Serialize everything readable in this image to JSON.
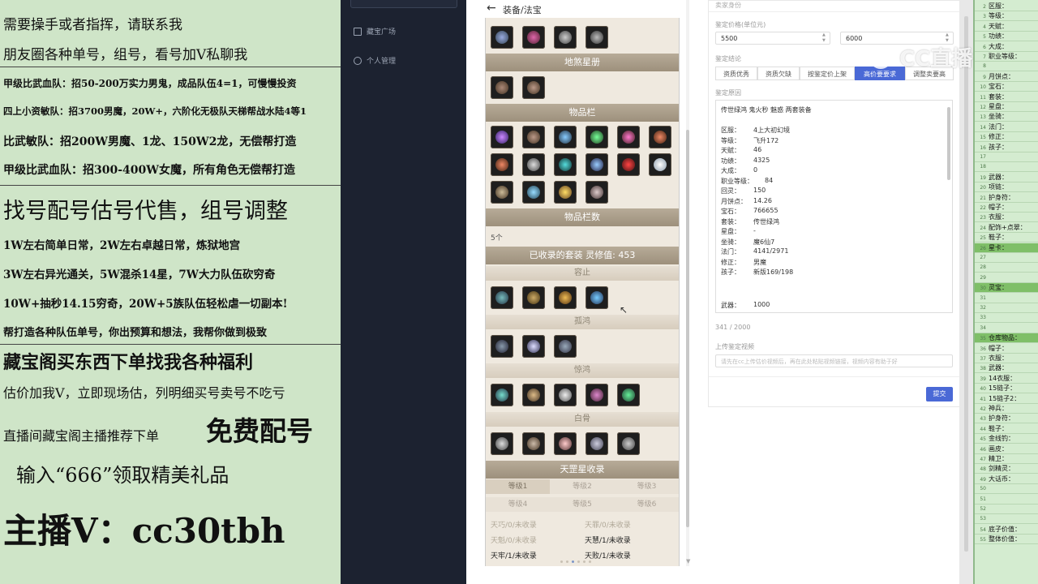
{
  "promo": {
    "lines": [
      "需要操手或者指挥，请联系我",
      "朋友圈各种单号，组号，看号加V私聊我",
      "甲级比武血队：招50-200万实力男鬼，成品队伍4=1，可慢慢投资",
      "四上小资敏队：招3700男魔，20W+，六阶化无极队天梯帮战水陆4等1",
      "比武敏队：招200W男魔、1龙、150W2龙，无偿帮打造",
      "甲级比武血队：招300-400W女魔，所有角色无偿帮打造",
      "找号配号估号代售，组号调整",
      "1W左右简单日常，2W左右卓越日常，炼狱地宫",
      "3W左右异光通关，5W混杀14星，7W大力队伍砍穷奇",
      "10W+抽秒14.15穷奇，20W+5族队伍轻松虐一切副本!",
      "帮打造各种队伍单号，你出预算和想法，我帮你做到极致",
      "藏宝阁买东西下单找我各种福利",
      "估价加我V，立即现场估，列明细买号卖号不吃亏",
      "直播间藏宝阁主播推荐下单",
      "免费配号",
      "输入“666”领取精美礼品",
      "主播V：cc30tbh"
    ]
  },
  "nav": {
    "items": [
      {
        "label": "藏宝广场",
        "icon": "store-icon"
      },
      {
        "label": "个人管理",
        "icon": "user-icon"
      }
    ]
  },
  "phone": {
    "title": "装备/法宝",
    "sections": {
      "star_album": "地煞星册",
      "inventory": "物品栏",
      "inventory_count_label": "物品栏数",
      "inventory_count": "5个",
      "suits_collected": "已收录的套装 灵修值: 453",
      "suit1": "容止",
      "suit2": "孤鸿",
      "suit3": "惊鸿",
      "suit4": "白骨",
      "tiangang": "天罡星收录"
    },
    "levels": [
      "等级1",
      "等级2",
      "等级3",
      "等级4",
      "等级5",
      "等级6"
    ],
    "collection": [
      {
        "text": "天巧/0/未收录",
        "dim": true
      },
      {
        "text": "天罪/0/未收录",
        "dim": true
      },
      {
        "text": "天魁/0/未收录",
        "dim": true
      },
      {
        "text": "天慧/1/未收录",
        "dim": false
      },
      {
        "text": "天牢/1/未收录",
        "dim": false
      },
      {
        "text": "天败/1/未收录",
        "dim": false
      }
    ]
  },
  "form": {
    "header": "卖家身份",
    "price_label": "鉴定价格(单位元)",
    "price_min": "5500",
    "price_max": "6000",
    "result_label": "鉴定结论",
    "result_options": [
      "资质优秀",
      "资质欠缺",
      "按鉴定价上架",
      "高价要要求",
      "调整卖要高"
    ],
    "active_option": 3,
    "reason_label": "鉴定原因",
    "reason_first": "传世绿鸿 鬼火秒 魅惑 两套装备",
    "reason_rows": [
      [
        "区服：",
        "4上大初幻境"
      ],
      [
        "等级：",
        "飞升172"
      ],
      [
        "天赋：",
        "46"
      ],
      [
        "功绩：",
        "4325"
      ],
      [
        "大成：",
        "0"
      ],
      [
        "职业等级：",
        "84"
      ],
      [
        "回灵：",
        "150"
      ],
      [
        "月饼点：",
        "14.26"
      ],
      [
        "宝石：",
        "766655"
      ],
      [
        "套装：",
        "传世绿鸿"
      ],
      [
        "星盘：",
        "-"
      ],
      [
        "坐骑：",
        "魔6仙7"
      ],
      [
        "法门：",
        "4141/2971"
      ],
      [
        "修正：",
        "男魔"
      ],
      [
        "孩子：",
        "新版169/198"
      ]
    ],
    "reason_tail": [
      "武器：",
      "1000"
    ],
    "char_count": "341 / 2000",
    "upload_label": "上传鉴定视频",
    "upload_placeholder": "请先在cc上传估价视频后，再在此处粘贴视频链接，视频内容有助于好",
    "submit": "提交"
  },
  "sheet": {
    "rows": [
      {
        "n": "2",
        "t": "区服：",
        "hl": false
      },
      {
        "n": "3",
        "t": "等级：",
        "hl": false
      },
      {
        "n": "4",
        "t": "天赋：",
        "hl": false
      },
      {
        "n": "5",
        "t": "功绩：",
        "hl": false
      },
      {
        "n": "6",
        "t": "大成：",
        "hl": false
      },
      {
        "n": "7",
        "t": "职业等级：",
        "hl": false
      },
      {
        "n": "8",
        "t": "",
        "hl": false
      },
      {
        "n": "9",
        "t": "月饼点：",
        "hl": false
      },
      {
        "n": "10",
        "t": "宝石：",
        "hl": false
      },
      {
        "n": "11",
        "t": "套装：",
        "hl": false
      },
      {
        "n": "12",
        "t": "星盘：",
        "hl": false
      },
      {
        "n": "13",
        "t": "坐骑：",
        "hl": false
      },
      {
        "n": "14",
        "t": "法门：",
        "hl": false
      },
      {
        "n": "15",
        "t": "修正：",
        "hl": false
      },
      {
        "n": "16",
        "t": "孩子：",
        "hl": false
      },
      {
        "n": "17",
        "t": "",
        "hl": false
      },
      {
        "n": "18",
        "t": "",
        "hl": false
      },
      {
        "n": "19",
        "t": "武器：",
        "hl": false
      },
      {
        "n": "20",
        "t": "项链：",
        "hl": false
      },
      {
        "n": "21",
        "t": "护身符：",
        "hl": false
      },
      {
        "n": "22",
        "t": "帽子：",
        "hl": false
      },
      {
        "n": "23",
        "t": "衣服：",
        "hl": false
      },
      {
        "n": "24",
        "t": "配饰+点翠：",
        "hl": false
      },
      {
        "n": "25",
        "t": "鞋子：",
        "hl": false
      },
      {
        "n": "26",
        "t": "星卡：",
        "hl": true
      },
      {
        "n": "27",
        "t": "",
        "hl": false
      },
      {
        "n": "28",
        "t": "",
        "hl": false
      },
      {
        "n": "29",
        "t": "",
        "hl": false
      },
      {
        "n": "30",
        "t": "灵宝：",
        "hl": true
      },
      {
        "n": "31",
        "t": "",
        "hl": false
      },
      {
        "n": "32",
        "t": "",
        "hl": false
      },
      {
        "n": "33",
        "t": "",
        "hl": false
      },
      {
        "n": "34",
        "t": "",
        "hl": false
      },
      {
        "n": "35",
        "t": "仓库物品：",
        "hl": true
      },
      {
        "n": "36",
        "t": "帽子：",
        "hl": false
      },
      {
        "n": "37",
        "t": "衣服：",
        "hl": false
      },
      {
        "n": "38",
        "t": "武器：",
        "hl": false
      },
      {
        "n": "39",
        "t": "14衣服：",
        "hl": false
      },
      {
        "n": "40",
        "t": "15链子：",
        "hl": false
      },
      {
        "n": "41",
        "t": "15链子2：",
        "hl": false
      },
      {
        "n": "42",
        "t": "神兵：",
        "hl": false
      },
      {
        "n": "43",
        "t": "护身符：",
        "hl": false
      },
      {
        "n": "44",
        "t": "鞋子：",
        "hl": false
      },
      {
        "n": "45",
        "t": "金线钓：",
        "hl": false
      },
      {
        "n": "46",
        "t": "画皮：",
        "hl": false
      },
      {
        "n": "47",
        "t": "精卫：",
        "hl": false
      },
      {
        "n": "48",
        "t": "剑精灵：",
        "hl": false
      },
      {
        "n": "49",
        "t": "大话币：",
        "hl": false
      },
      {
        "n": "50",
        "t": "",
        "hl": false
      },
      {
        "n": "51",
        "t": "",
        "hl": false
      },
      {
        "n": "52",
        "t": "",
        "hl": false
      },
      {
        "n": "53",
        "t": "",
        "hl": false
      },
      {
        "n": "54",
        "t": "底子价值：",
        "hl": false
      },
      {
        "n": "55",
        "t": "整体价值：",
        "hl": false
      }
    ]
  },
  "watermark": "CC直播",
  "colors": {
    "promo_bg": "#cfe5c8",
    "nav_bg": "#1c2230",
    "accent": "#4a69d6",
    "section_header": "#a89c88"
  }
}
